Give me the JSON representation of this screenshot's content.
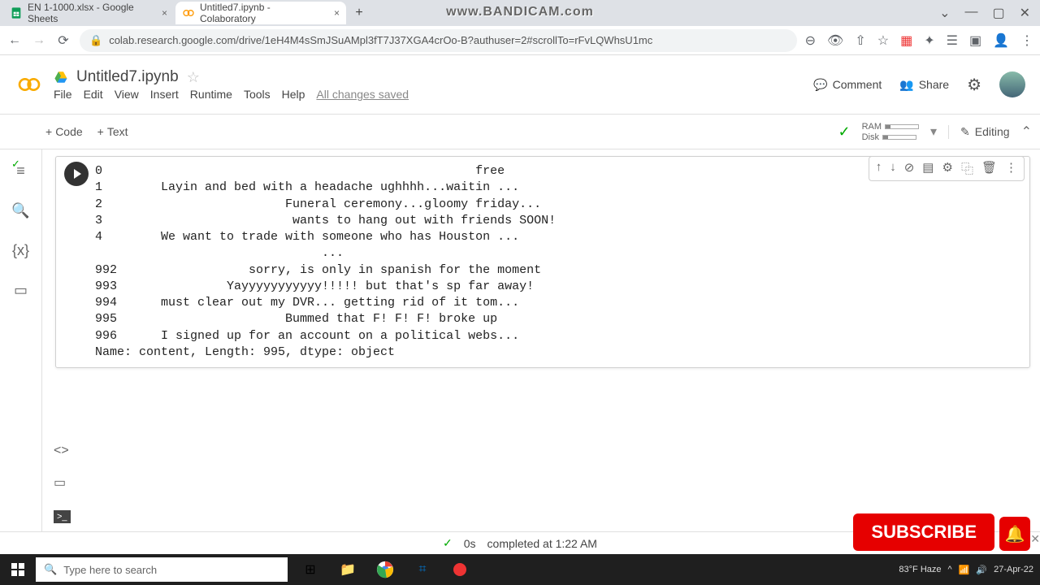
{
  "tabs": {
    "t1": "EN 1-1000.xlsx - Google Sheets",
    "t2": "Untitled7.ipynb - Colaboratory"
  },
  "url": "colab.research.google.com/drive/1eH4M4sSmJSuAMpl3fT7J37XGA4crOo-B?authuser=2#scrollTo=rFvLQWhsU1mc",
  "watermark": "www.BANDICAM.com",
  "notebook": {
    "title": "Untitled7.ipynb",
    "saved": "All changes saved"
  },
  "menu": {
    "file": "File",
    "edit": "Edit",
    "view": "View",
    "insert": "Insert",
    "runtime": "Runtime",
    "tools": "Tools",
    "help": "Help"
  },
  "header_buttons": {
    "comment": "Comment",
    "share": "Share"
  },
  "toolbar": {
    "code": "Code",
    "text": "Text",
    "editing": "Editing",
    "ram": "RAM",
    "disk": "Disk"
  },
  "output_lines": "0                                                   free\n1        Layin and bed with a headache ughhhh...waitin ...\n2                         Funeral ceremony...gloomy friday...\n3                          wants to hang out with friends SOON!\n4        We want to trade with someone who has Houston ...\n                               ...                        \n992                  sorry, is only in spanish for the moment\n993               Yayyyyyyyyyyy!!!!! but that's sp far away!\n994      must clear out my DVR... getting rid of it tom...\n995                       Bummed that F! F! F! broke up\n996      I signed up for an account on a political webs...\nName: content, Length: 995, dtype: object",
  "status": {
    "time": "0s",
    "msg": "completed at 1:22 AM"
  },
  "taskbar": {
    "search_placeholder": "Type here to search",
    "weather": "83°F Haze",
    "date": "27-Apr-22"
  },
  "subscribe": "SUBSCRIBE"
}
